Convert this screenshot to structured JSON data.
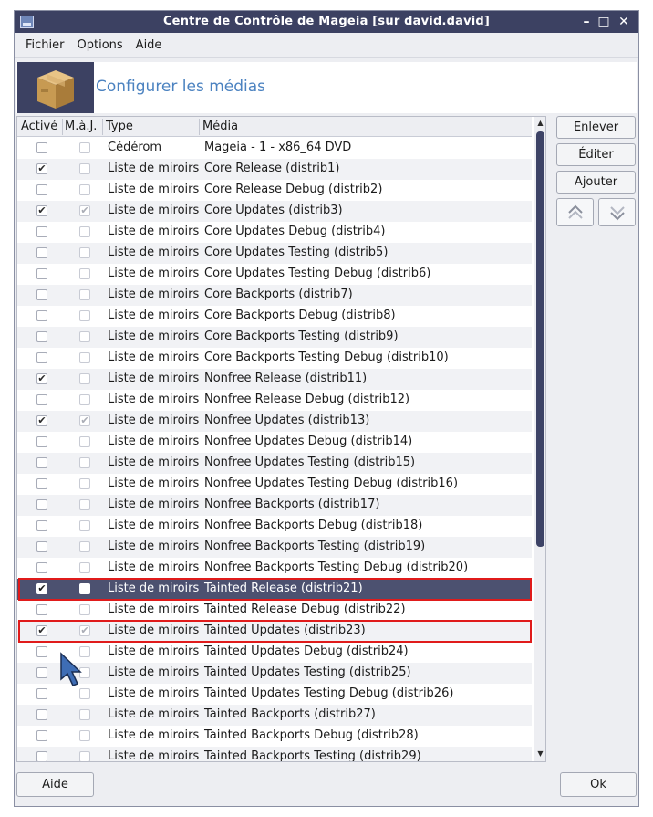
{
  "window": {
    "title": "Centre de Contrôle de Mageia  [sur david.david]",
    "controls": {
      "minimize": "–",
      "maximize": "□",
      "close": "✕"
    }
  },
  "menu": {
    "fichier": "Fichier",
    "options": "Options",
    "aide": "Aide"
  },
  "banner": {
    "title": "Configurer les médias",
    "icon": "package-box-icon"
  },
  "columns": {
    "active": "Activé",
    "update": "M.à.J.",
    "type": "Type",
    "media": "Média"
  },
  "rows": [
    {
      "type": "Cédérom",
      "media": "Mageia - 1 - x86_64 DVD",
      "active": false,
      "update": false
    },
    {
      "type": "Liste de miroirs",
      "media": "Core Release (distrib1)",
      "active": true,
      "update": false
    },
    {
      "type": "Liste de miroirs",
      "media": "Core Release Debug (distrib2)",
      "active": false,
      "update": false
    },
    {
      "type": "Liste de miroirs",
      "media": "Core Updates (distrib3)",
      "active": true,
      "update": true
    },
    {
      "type": "Liste de miroirs",
      "media": "Core Updates Debug (distrib4)",
      "active": false,
      "update": false
    },
    {
      "type": "Liste de miroirs",
      "media": "Core Updates Testing (distrib5)",
      "active": false,
      "update": false
    },
    {
      "type": "Liste de miroirs",
      "media": "Core Updates Testing Debug (distrib6)",
      "active": false,
      "update": false
    },
    {
      "type": "Liste de miroirs",
      "media": "Core Backports (distrib7)",
      "active": false,
      "update": false
    },
    {
      "type": "Liste de miroirs",
      "media": "Core Backports Debug (distrib8)",
      "active": false,
      "update": false
    },
    {
      "type": "Liste de miroirs",
      "media": "Core Backports Testing (distrib9)",
      "active": false,
      "update": false
    },
    {
      "type": "Liste de miroirs",
      "media": "Core Backports Testing Debug (distrib10)",
      "active": false,
      "update": false
    },
    {
      "type": "Liste de miroirs",
      "media": "Nonfree Release (distrib11)",
      "active": true,
      "update": false
    },
    {
      "type": "Liste de miroirs",
      "media": "Nonfree Release Debug (distrib12)",
      "active": false,
      "update": false
    },
    {
      "type": "Liste de miroirs",
      "media": "Nonfree Updates (distrib13)",
      "active": true,
      "update": true
    },
    {
      "type": "Liste de miroirs",
      "media": "Nonfree Updates Debug (distrib14)",
      "active": false,
      "update": false
    },
    {
      "type": "Liste de miroirs",
      "media": "Nonfree Updates Testing (distrib15)",
      "active": false,
      "update": false
    },
    {
      "type": "Liste de miroirs",
      "media": "Nonfree Updates Testing Debug (distrib16)",
      "active": false,
      "update": false
    },
    {
      "type": "Liste de miroirs",
      "media": "Nonfree Backports (distrib17)",
      "active": false,
      "update": false
    },
    {
      "type": "Liste de miroirs",
      "media": "Nonfree Backports Debug (distrib18)",
      "active": false,
      "update": false
    },
    {
      "type": "Liste de miroirs",
      "media": "Nonfree Backports Testing (distrib19)",
      "active": false,
      "update": false
    },
    {
      "type": "Liste de miroirs",
      "media": "Nonfree Backports Testing Debug (distrib20)",
      "active": false,
      "update": false
    },
    {
      "type": "Liste de miroirs",
      "media": "Tainted Release (distrib21)",
      "active": true,
      "update": false,
      "selected": true,
      "highlighted": true
    },
    {
      "type": "Liste de miroirs",
      "media": "Tainted Release Debug (distrib22)",
      "active": false,
      "update": false
    },
    {
      "type": "Liste de miroirs",
      "media": "Tainted Updates (distrib23)",
      "active": true,
      "update": true,
      "highlighted": true
    },
    {
      "type": "Liste de miroirs",
      "media": "Tainted Updates Debug (distrib24)",
      "active": false,
      "update": false
    },
    {
      "type": "Liste de miroirs",
      "media": "Tainted Updates Testing (distrib25)",
      "active": false,
      "update": false
    },
    {
      "type": "Liste de miroirs",
      "media": "Tainted Updates Testing Debug (distrib26)",
      "active": false,
      "update": false
    },
    {
      "type": "Liste de miroirs",
      "media": "Tainted Backports (distrib27)",
      "active": false,
      "update": false
    },
    {
      "type": "Liste de miroirs",
      "media": "Tainted Backports Debug (distrib28)",
      "active": false,
      "update": false
    },
    {
      "type": "Liste de miroirs",
      "media": "Tainted Backports Testing (distrib29)",
      "active": false,
      "update": false
    }
  ],
  "side_buttons": {
    "remove": "Enlever",
    "edit": "Éditer",
    "add": "Ajouter",
    "move_up": "move-up-icon",
    "move_down": "move-down-icon"
  },
  "footer": {
    "help": "Aide",
    "ok": "Ok"
  },
  "colors": {
    "titlebar": "#3c4162",
    "selected_row": "#4c5170",
    "heading": "#4b82c0",
    "highlight": "#e01b1b"
  }
}
